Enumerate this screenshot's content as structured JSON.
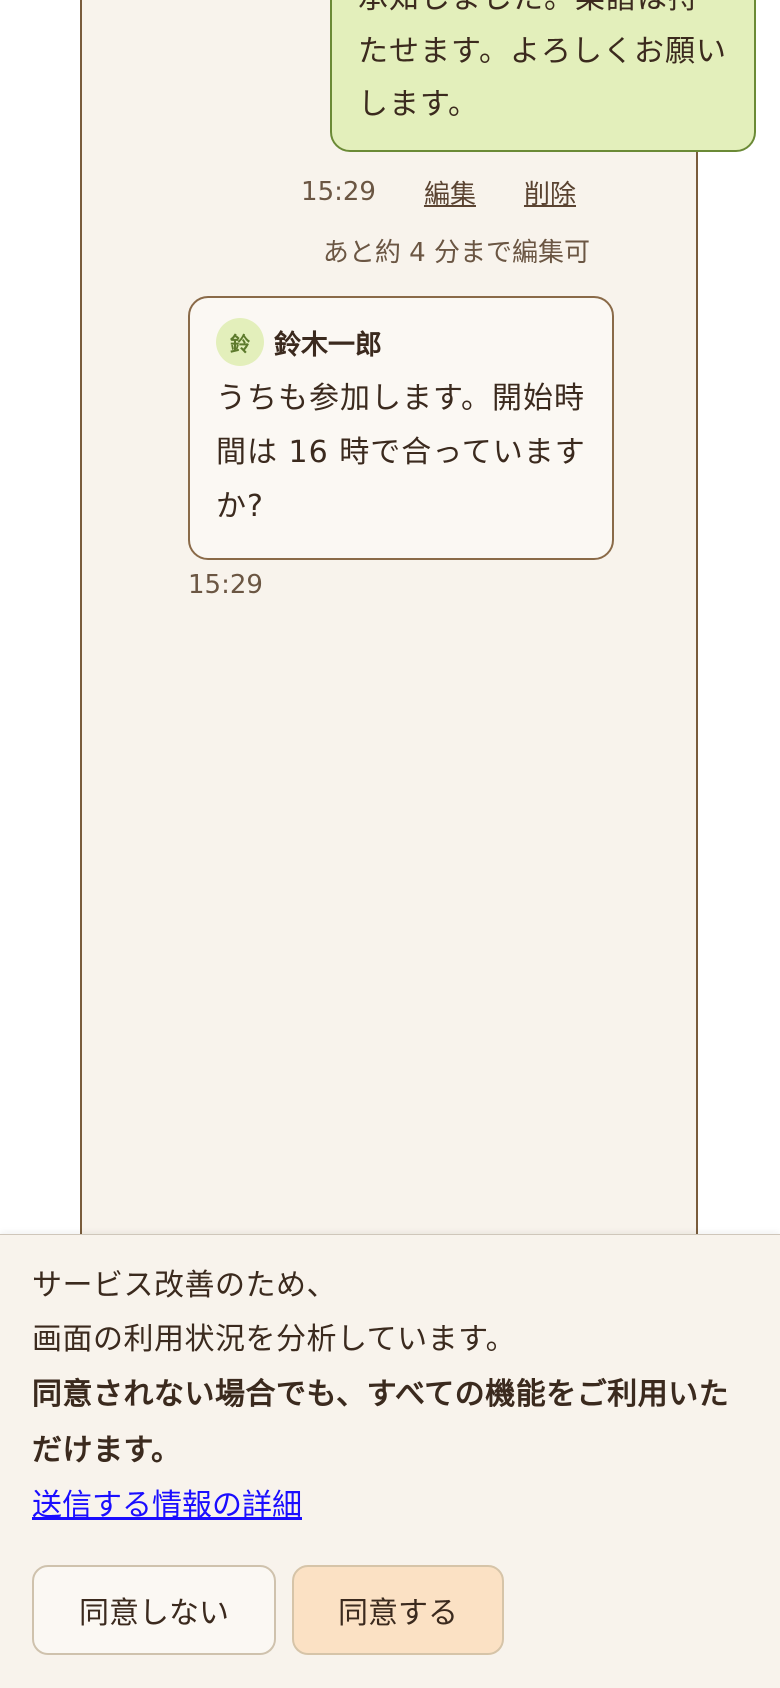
{
  "chat": {
    "own_message": {
      "text": "承知しました。楽譜は持たせます。よろしくお願いします。",
      "time": "15:29",
      "edit_label": "編集",
      "delete_label": "削除",
      "edit_notice": "あと約 4 分まで編集可"
    },
    "other_message": {
      "avatar_initial": "鈴",
      "sender": "鈴木一郎",
      "text": "うちも参加します。開始時間は 16 時で合っていますか?",
      "time": "15:29"
    }
  },
  "consent": {
    "line1": "サービス改善のため、",
    "line2": "画面の利用状況を分析しています。",
    "strong": "同意されない場合でも、すべての機能をご利用いただけます。",
    "link": "送信する情報の詳細",
    "decline_label": "同意しない",
    "accept_label": "同意する"
  },
  "colors": {
    "panel_bg": "#f8f3ec",
    "panel_border": "#7a5c3c",
    "own_bubble_bg": "#e3efbb",
    "own_bubble_border": "#6b8a36",
    "accept_button_bg": "#fbe1c4",
    "link": "#1a0dff"
  }
}
